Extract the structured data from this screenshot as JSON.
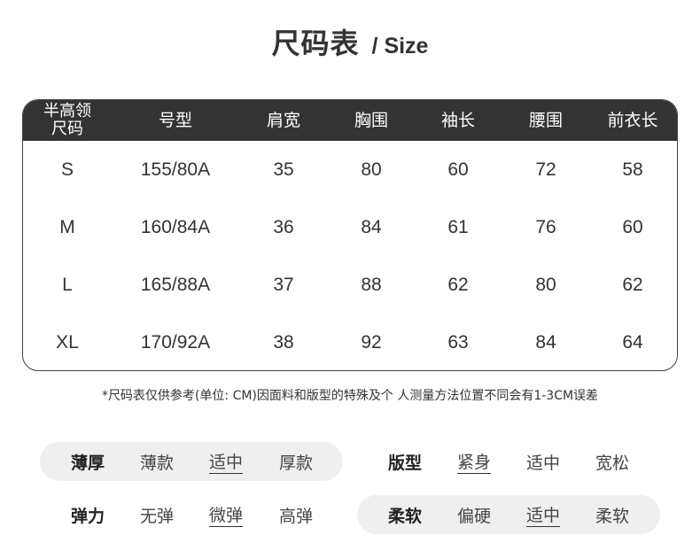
{
  "title": {
    "main": "尺码表",
    "sub": "/ Size"
  },
  "table": {
    "headers": [
      "半高领尺码",
      "号型",
      "肩宽",
      "胸围",
      "袖长",
      "腰围",
      "前衣长"
    ],
    "rows": [
      [
        "S",
        "155/80A",
        "35",
        "80",
        "60",
        "72",
        "58"
      ],
      [
        "M",
        "160/84A",
        "36",
        "84",
        "61",
        "76",
        "60"
      ],
      [
        "L",
        "165/88A",
        "37",
        "88",
        "62",
        "80",
        "62"
      ],
      [
        "XL",
        "170/92A",
        "38",
        "92",
        "63",
        "84",
        "64"
      ]
    ]
  },
  "note": "*尺码表仅供参考(单位: CM)因面料和版型的特殊及个 人测量方法位置不同会有1-3CM误差",
  "attributes": [
    {
      "label": "薄厚",
      "options": [
        "薄款",
        "适中",
        "厚款"
      ],
      "selected": "适中"
    },
    {
      "label": "版型",
      "options": [
        "紧身",
        "适中",
        "宽松"
      ],
      "selected": "紧身"
    },
    {
      "label": "弹力",
      "options": [
        "无弹",
        "微弹",
        "高弹"
      ],
      "selected": "微弹"
    },
    {
      "label": "柔软",
      "options": [
        "偏硬",
        "适中",
        "柔软"
      ],
      "selected": "适中"
    }
  ],
  "colors": {
    "header_bg": "#333333",
    "pill_bg": "#efefef",
    "text": "#333333"
  }
}
